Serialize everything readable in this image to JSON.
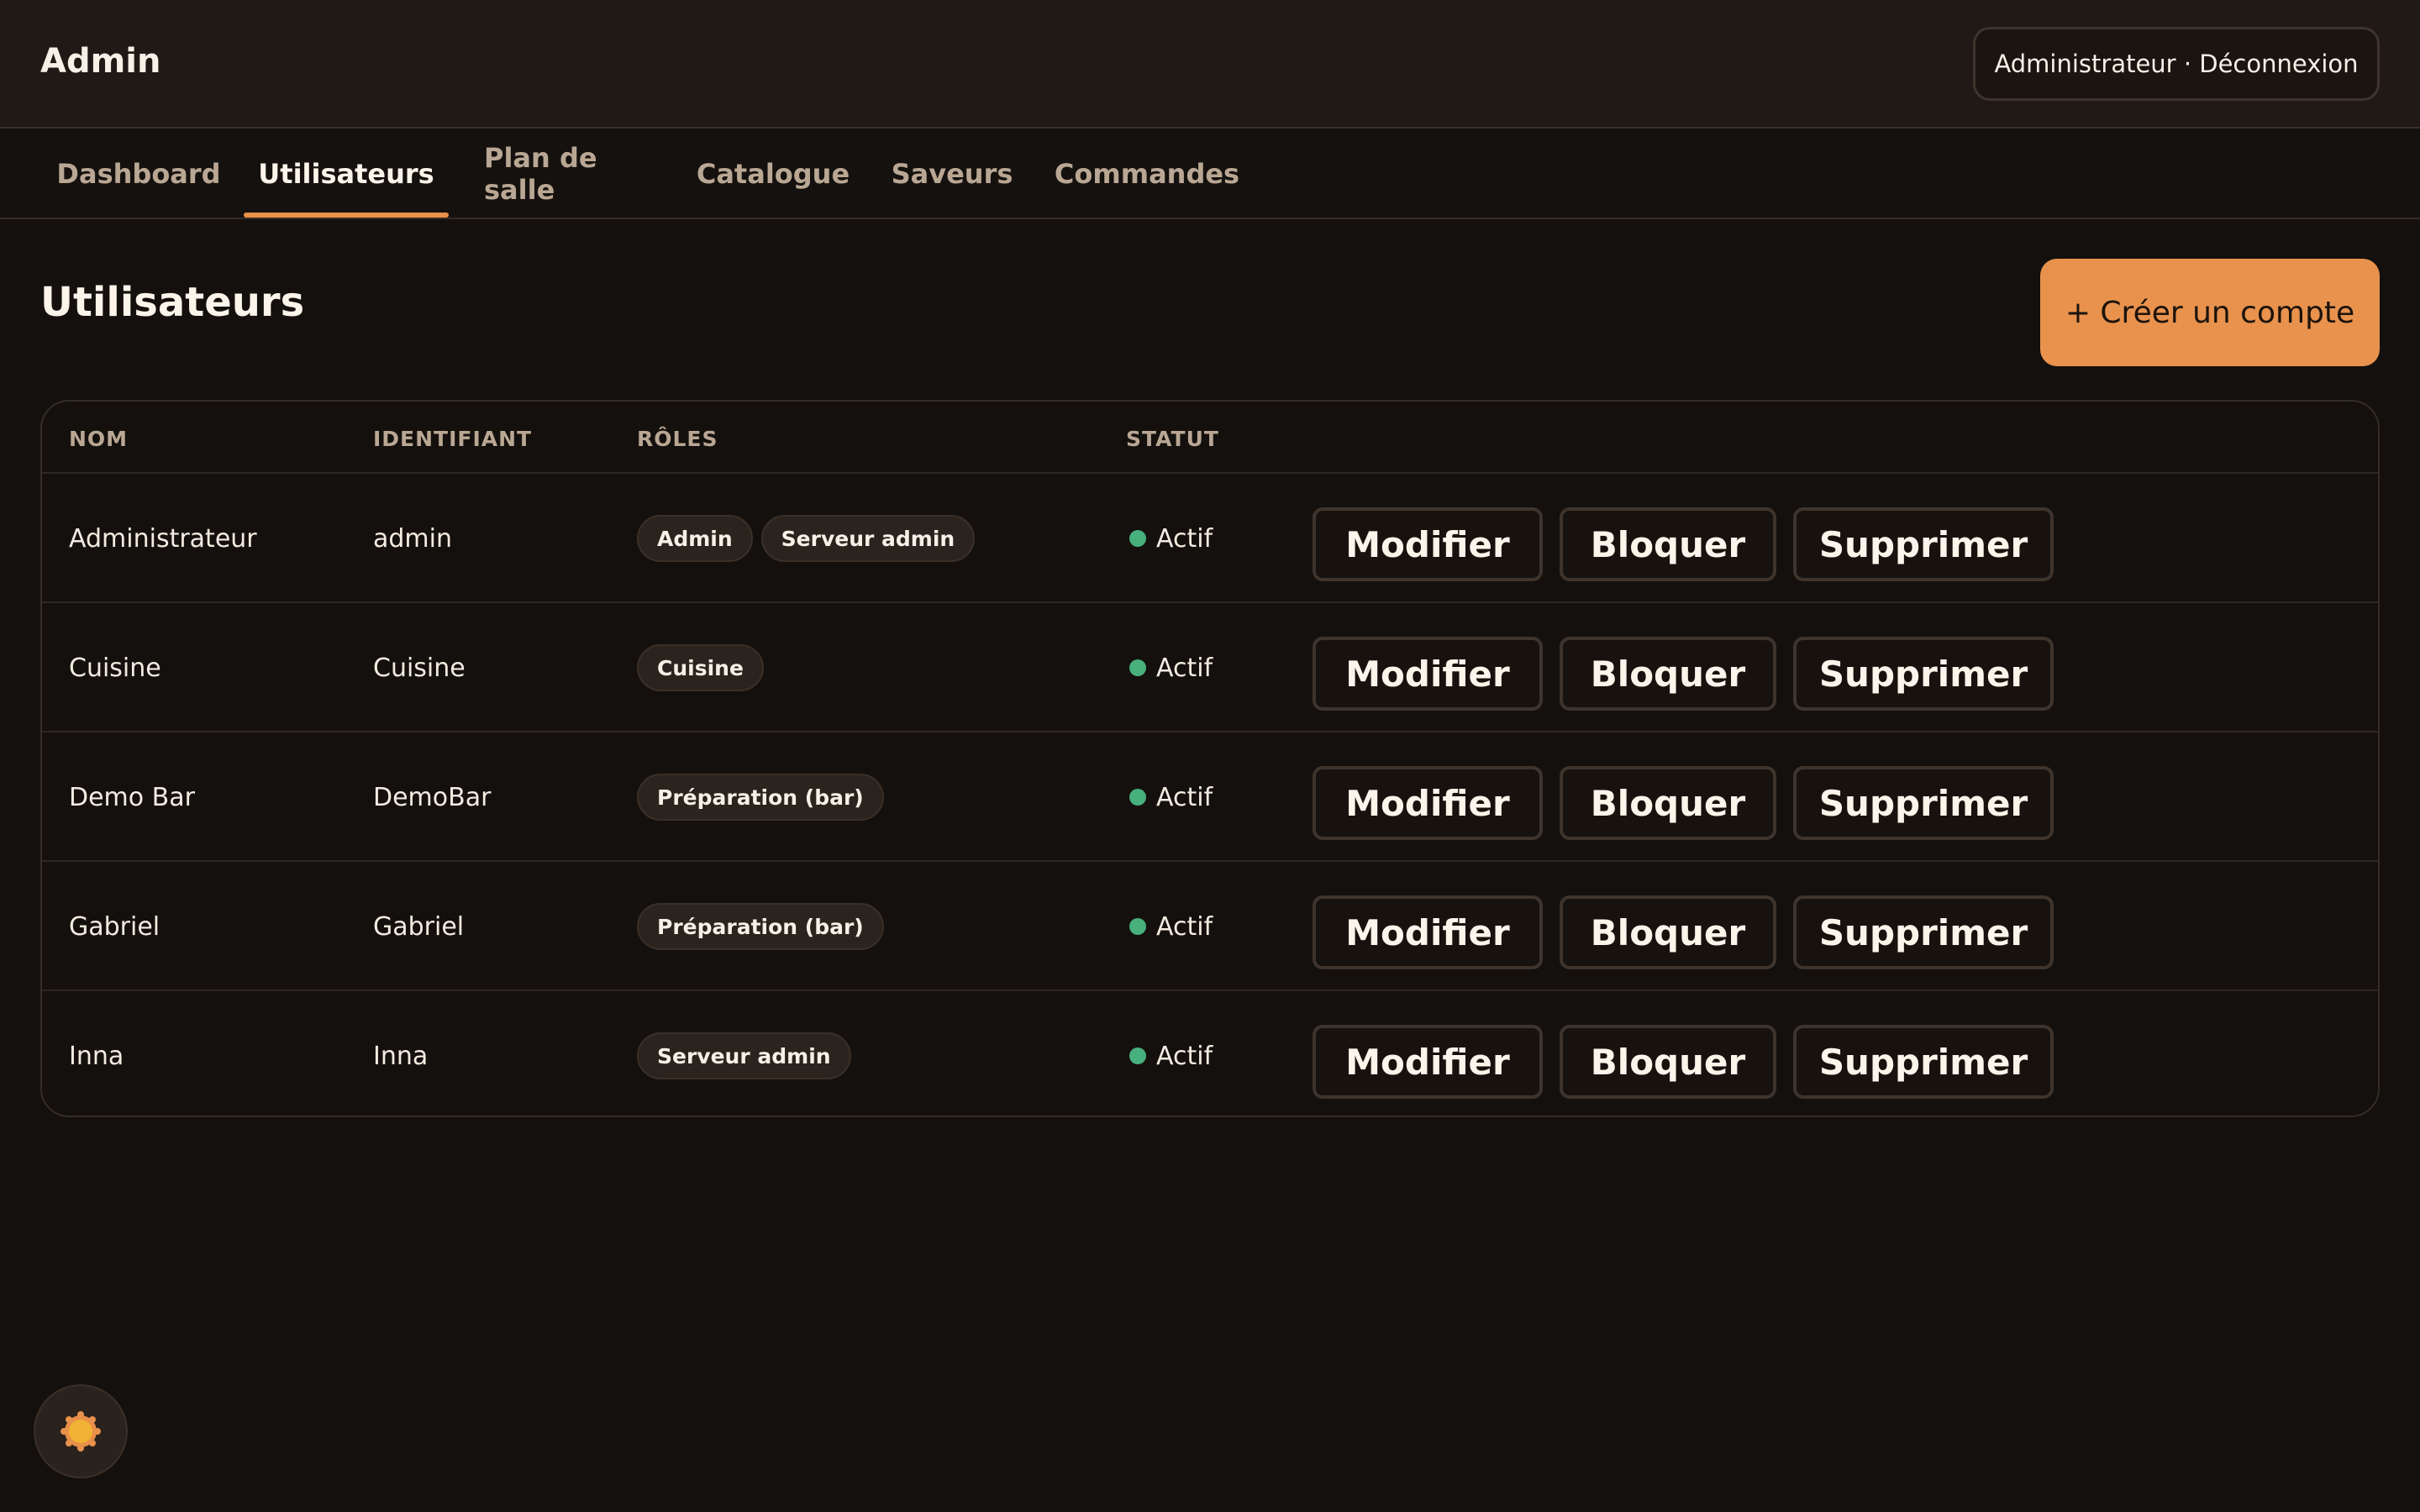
{
  "header": {
    "brand": "Admin",
    "session_label": "Administrateur · Déconnexion"
  },
  "tabs": [
    {
      "label": "Dashboard",
      "active": false
    },
    {
      "label": "Utilisateurs",
      "active": true
    },
    {
      "label": "Plan de salle",
      "active": false
    },
    {
      "label": "Catalogue",
      "active": false
    },
    {
      "label": "Saveurs",
      "active": false
    },
    {
      "label": "Commandes",
      "active": false
    }
  ],
  "page": {
    "title": "Utilisateurs",
    "create_button": "+ Créer un compte"
  },
  "table": {
    "columns": [
      "NOM",
      "IDENTIFIANT",
      "RÔLES",
      "STATUT"
    ],
    "actions": {
      "edit": "Modifier",
      "block": "Bloquer",
      "delete": "Supprimer"
    },
    "rows": [
      {
        "name": "Administrateur",
        "login": "admin",
        "roles": [
          "Admin",
          "Serveur admin"
        ],
        "status": "Actif"
      },
      {
        "name": "Cuisine",
        "login": "Cuisine",
        "roles": [
          "Cuisine"
        ],
        "status": "Actif"
      },
      {
        "name": "Demo Bar",
        "login": "DemoBar",
        "roles": [
          "Préparation (bar)"
        ],
        "status": "Actif"
      },
      {
        "name": "Gabriel",
        "login": "Gabriel",
        "roles": [
          "Préparation (bar)"
        ],
        "status": "Actif"
      },
      {
        "name": "Inna",
        "login": "Inna",
        "roles": [
          "Serveur admin"
        ],
        "status": "Actif"
      }
    ]
  },
  "theme_toggle": {
    "icon": "sun-icon"
  },
  "colors": {
    "accent": "#e8924d",
    "status_active": "#47b07c",
    "background": "#13100d"
  }
}
